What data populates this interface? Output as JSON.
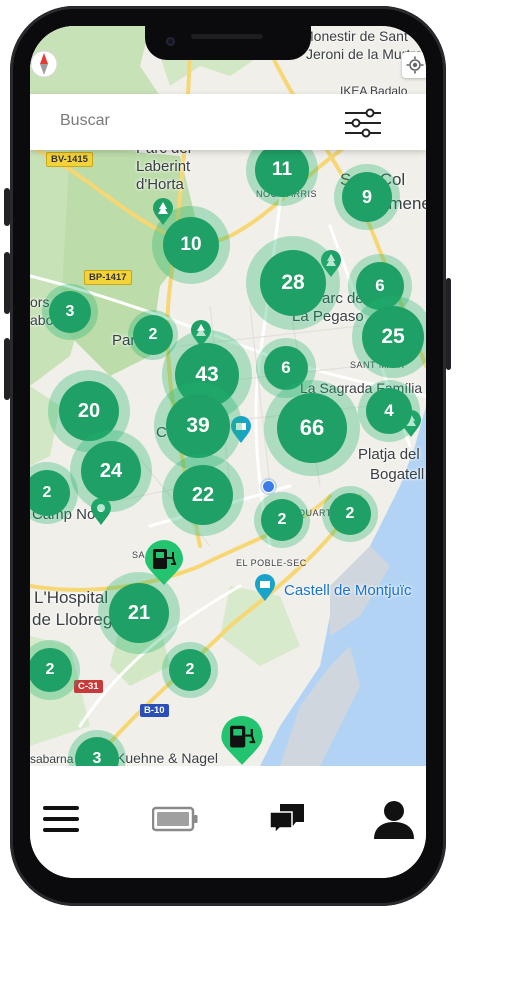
{
  "search": {
    "placeholder": "Buscar"
  },
  "map_labels": {
    "monestir": "Monestir de Sant",
    "jeroni": "Jeroni de la Murtra",
    "ikea": "IKEA Badalo",
    "laberint_1": "Parc del",
    "laberint_2": "Laberint",
    "laberint_3": "d'Horta",
    "nou_barris": "NOU BARRIS",
    "sant_col_1": "Sant Col",
    "sant_col_2": "Gramene",
    "pegaso_1": "Parc de",
    "pegaso_2": "La Pegaso",
    "sant_mart": "SANT MART",
    "sagrada": "La Sagrada Família",
    "platja_1": "Platja del",
    "platja_2": "Bogatell",
    "park_left": "Park",
    "cam": "Cam",
    "camp_nou": "Camp Nou",
    "quart": "QUART",
    "poble_sec": "EL POBLE-SEC",
    "montjuic": "Castell de Montjuïc",
    "hospital_1": "L'Hospital",
    "hospital_2": "de Llobreg",
    "kuehne": "Kuehne & Nagel",
    "sabarna": "sabarna",
    "sant": "SA",
    "horta_parc": "Parc",
    "rest_1": "ors",
    "rest_2": "abo"
  },
  "road_signs": {
    "bv1415": "BV-1415",
    "bp1417": "BP-1417",
    "c31": "C-31",
    "b10": "B-10"
  },
  "clusters": [
    {
      "count": "11"
    },
    {
      "count": "9"
    },
    {
      "count": "10"
    },
    {
      "count": "28"
    },
    {
      "count": "6"
    },
    {
      "count": "3"
    },
    {
      "count": "2"
    },
    {
      "count": "25"
    },
    {
      "count": "43"
    },
    {
      "count": "6"
    },
    {
      "count": "20"
    },
    {
      "count": "39"
    },
    {
      "count": "66"
    },
    {
      "count": "4"
    },
    {
      "count": "24"
    },
    {
      "count": "2"
    },
    {
      "count": "22"
    },
    {
      "count": "2"
    },
    {
      "count": "2"
    },
    {
      "count": "21"
    },
    {
      "count": "2"
    },
    {
      "count": "2"
    },
    {
      "count": "3"
    }
  ],
  "nav": {
    "items": [
      {
        "icon": "menu-icon"
      },
      {
        "icon": "battery-icon"
      },
      {
        "icon": "chat-icon"
      },
      {
        "icon": "profile-icon"
      }
    ]
  },
  "colors": {
    "cluster": "#1fa067",
    "halo": "rgba(31,179,110,0.32)",
    "sea": "#b3d3f5",
    "park": "#cfe6c2"
  }
}
